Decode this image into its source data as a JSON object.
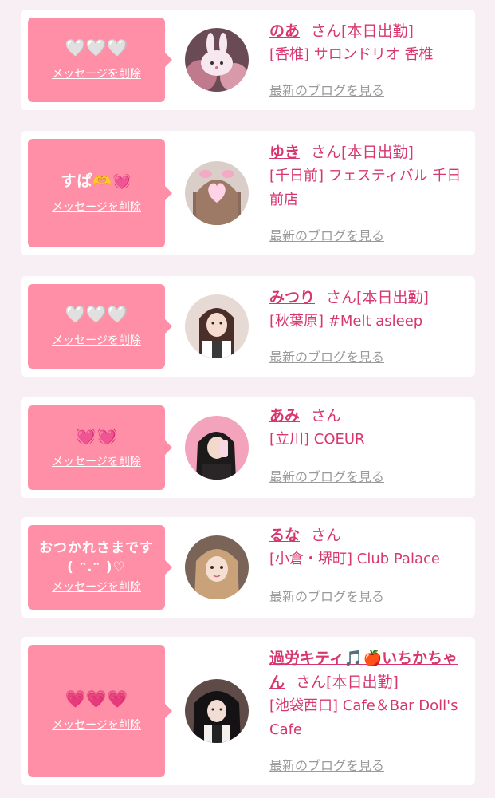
{
  "delete_label": "メッセージを削除",
  "blog_label": "最新のブログを見る",
  "honorific": "さん",
  "entries": [
    {
      "message": "🤍🤍🤍",
      "name": "のあ",
      "status": "[本日出勤]",
      "shop": "[香椎] サロンドリオ 香椎",
      "avatar_icon": "avatar-bunny-photo"
    },
    {
      "message": "すぱ🫶💓",
      "name": "ゆき",
      "status": "[本日出勤]",
      "shop": "[千日前] フェスティバル 千日前店",
      "avatar_icon": "avatar-heart-face-photo"
    },
    {
      "message": "🤍🤍🤍",
      "name": "みつり",
      "status": "[本日出勤]",
      "shop": "[秋葉原] #Melt asleep",
      "avatar_icon": "avatar-maid-photo"
    },
    {
      "message": "💓💓",
      "name": "あみ",
      "status": "",
      "shop": "[立川] COEUR",
      "avatar_icon": "avatar-pink-photo"
    },
    {
      "message": "おつかれさまです\n ( ᵔ.ᵔ )♡",
      "name": "るな",
      "status": "",
      "shop": "[小倉・堺町] Club Palace",
      "avatar_icon": "avatar-blonde-photo"
    },
    {
      "message": "💗💗💗",
      "name": "過労キティ🎵🍎いちかちゃん",
      "status": "[本日出勤]",
      "shop": "[池袋西口] Cafe＆Bar Doll's Cafe",
      "avatar_icon": "avatar-dark-hair-photo"
    }
  ]
}
